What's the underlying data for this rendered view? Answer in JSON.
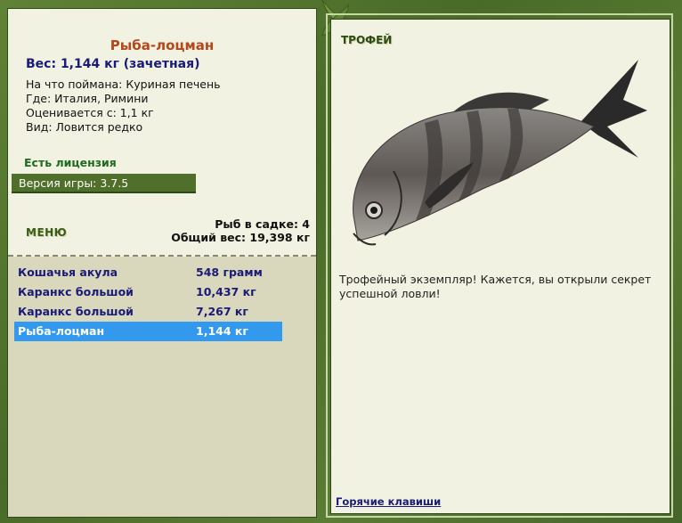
{
  "details": {
    "fish_name": "Рыба-лоцман",
    "weight_line": "Вес: 1,144 кг (зачетная)",
    "bait_line": "На что поймана: Куриная печень",
    "location_line": "Где: Италия, Римини",
    "valued_line": "Оценивается с: 1,1 кг",
    "type_line": "Вид: Ловится редко"
  },
  "license": "Есть лицензия",
  "version": "Версия игры: 3.7.5",
  "menu_label": "МЕНЮ",
  "keepnet": {
    "count_line": "Рыб в садке: 4",
    "total_line": "Общий вес: 19,398 кг"
  },
  "catch_list": [
    {
      "name": "Кошачья акула",
      "weight": "548 грамм",
      "selected": false
    },
    {
      "name": "Каранкс большой",
      "weight": "10,437 кг",
      "selected": false
    },
    {
      "name": "Каранкс большой",
      "weight": "7,267 кг",
      "selected": false
    },
    {
      "name": "Рыба-лоцман",
      "weight": "1,144 кг",
      "selected": true
    }
  ],
  "trophy": {
    "title": "ТРОФЕЙ",
    "message": "Трофейный экземпляр! Кажется, вы открыли секрет успешной ловли!",
    "hotkeys_link": "Горячие клавиши"
  },
  "colors": {
    "frame_green": "#4e6e2c",
    "panel_bg": "#f2f2e2",
    "fish_name": "#b5471a",
    "selection": "#3399ee"
  }
}
